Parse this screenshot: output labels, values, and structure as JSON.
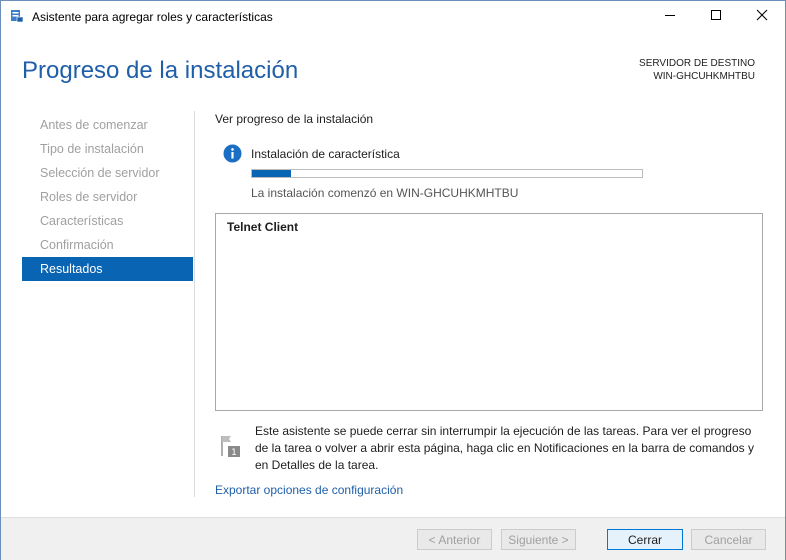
{
  "window": {
    "title": "Asistente para agregar roles y características",
    "app_icon": "server-manager-icon",
    "controls": [
      "minimize-icon",
      "maximize-icon",
      "close-icon"
    ]
  },
  "header": {
    "title": "Progreso de la instalación",
    "destination_label": "SERVIDOR DE DESTINO",
    "destination_server": "WIN-GHCUHKMHTBU"
  },
  "nav": {
    "items": [
      {
        "label": "Antes de comenzar",
        "active": false
      },
      {
        "label": "Tipo de instalación",
        "active": false
      },
      {
        "label": "Selección de servidor",
        "active": false
      },
      {
        "label": "Roles de servidor",
        "active": false
      },
      {
        "label": "Características",
        "active": false
      },
      {
        "label": "Confirmación",
        "active": false
      },
      {
        "label": "Resultados",
        "active": true
      }
    ]
  },
  "content": {
    "section_title": "Ver progreso de la instalación",
    "status_icon": "info-icon",
    "status": "Instalación de característica",
    "progress_fraction": 0.1,
    "started_message": "La instalación comenzó en WIN-GHCUHKMHTBU",
    "features": [
      "Telnet Client"
    ],
    "note_icon": "notification-flag-icon",
    "note_badge": "1",
    "note": "Este asistente se puede cerrar sin interrumpir la ejecución de las tareas. Para ver el progreso de la tarea o volver a abrir esta página, haga clic en Notificaciones en la barra de comandos y en Detalles de la tarea.",
    "export_link": "Exportar opciones de configuración"
  },
  "footer": {
    "previous": "< Anterior",
    "next": "Siguiente >",
    "close": "Cerrar",
    "cancel": "Cancelar"
  },
  "colors": {
    "accent": "#0a64b4",
    "title": "#1f5fa8",
    "disabled_text": "#a0a0a0"
  }
}
